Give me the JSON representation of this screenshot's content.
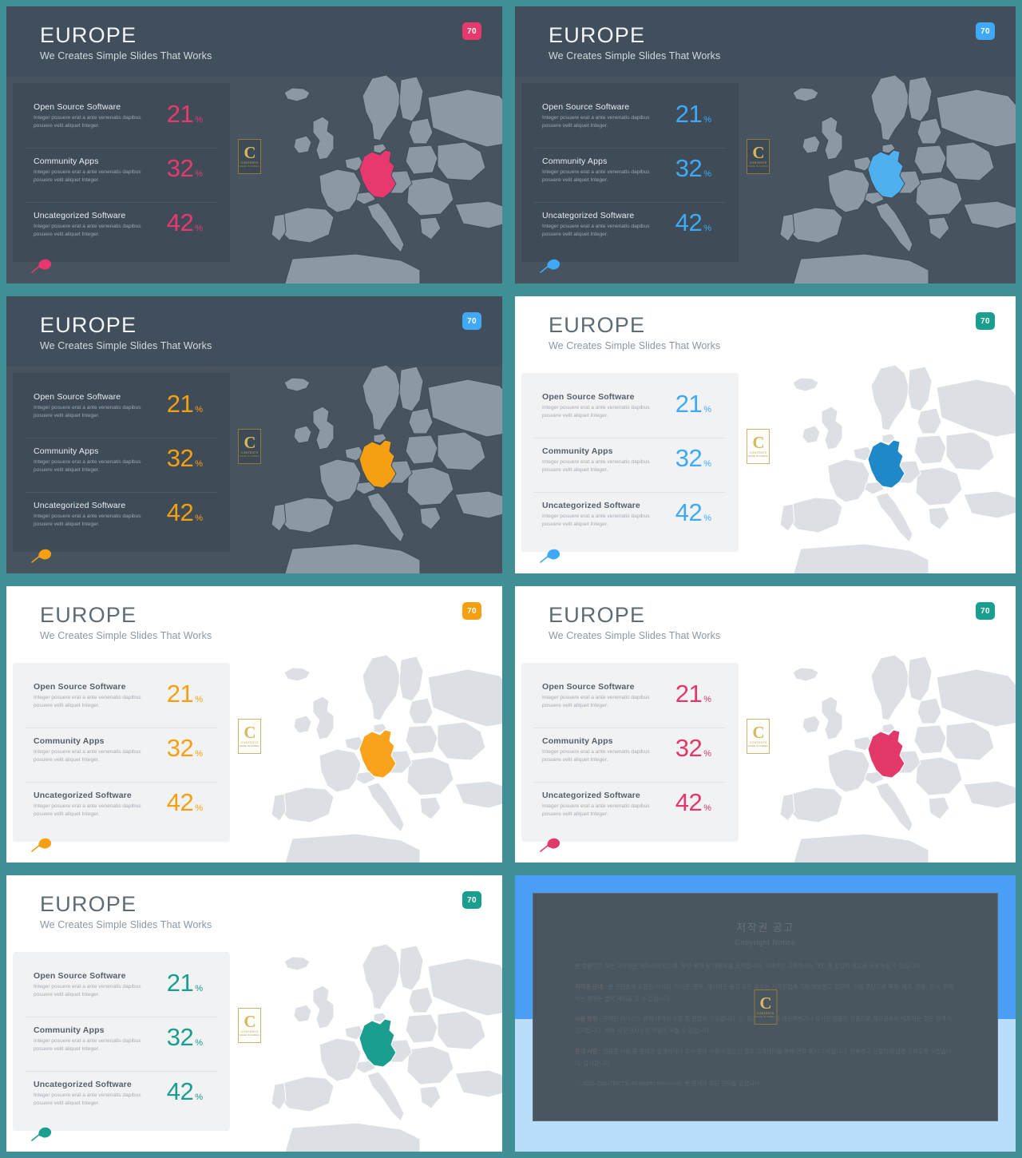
{
  "theme": {
    "frame": "#3f8f94",
    "dark_bg": "#414f5c",
    "dark_body": "#47545f",
    "dark_card": "#3f4c58",
    "light_card": "#f1f2f4",
    "pink": "#e8396f",
    "blue": "#3fa9f5",
    "orange": "#f5a011",
    "teal": "#1b9e8f",
    "blue_dark": "#1f88c9",
    "map_land_dark": "#8c99a4",
    "map_sea_dark": "#3f4d5a",
    "map_land_light": "#dcdfe4"
  },
  "header": {
    "title": "EUROPE",
    "subtitle": "We Creates Simple Slides That Works",
    "badge": "70"
  },
  "logo": {
    "letter": "C",
    "name": "CONTENTS",
    "tagline": "MADE IN KOREA"
  },
  "stats": [
    {
      "title": "Open Source Software",
      "desc": "Integer posuere erat a ante venenatis dapibus posuere velit aliquet Integer.",
      "value": "21",
      "unit": "%"
    },
    {
      "title": "Community Apps",
      "desc": "Integer posuere erat a ante venenatis dapibus posuere velit aliquet Integer.",
      "value": "32",
      "unit": "%"
    },
    {
      "title": "Uncategorized Software",
      "desc": "Integer posuere erat a ante venenatis dapibus posuere velit aliquet Integer.",
      "value": "42",
      "unit": "%"
    }
  ],
  "slides": [
    {
      "id": "slide-1",
      "mode": "dark",
      "accent": "#e8396f",
      "badge_color": "#e8396f",
      "highlight": "#e8396f",
      "pin": "#e8396f"
    },
    {
      "id": "slide-2",
      "mode": "dark",
      "accent": "#3fa9f5",
      "badge_color": "#3fa9f5",
      "highlight": "#4fb0f0",
      "pin": "#3fa9f5"
    },
    {
      "id": "slide-3",
      "mode": "dark",
      "accent": "#f5a011",
      "badge_color": "#3fa9f5",
      "highlight": "#f5a011",
      "pin": "#f5a011"
    },
    {
      "id": "slide-4",
      "mode": "light",
      "accent": "#3fa9f5",
      "badge_color": "#1b9e8f",
      "highlight": "#1f88c9",
      "pin": "#3fa9f5"
    },
    {
      "id": "slide-5",
      "mode": "light",
      "accent": "#f5a011",
      "badge_color": "#f5a011",
      "highlight": "#f9a21b",
      "pin": "#f5a011"
    },
    {
      "id": "slide-6",
      "mode": "light",
      "accent": "#e2386a",
      "badge_color": "#1b9e8f",
      "highlight": "#e2386a",
      "pin": "#e2386a"
    },
    {
      "id": "slide-7",
      "mode": "light",
      "accent": "#1b9e8f",
      "badge_color": "#1b9e8f",
      "highlight": "#1b9e8f",
      "pin": "#1b9e8f"
    }
  ],
  "copyright": {
    "title": "저작권 공고",
    "subtitle": "Copyright Notice",
    "paragraphs": [
      "본 템플릿의 모든 저작권은 제작사에 있으며, 무단 복제 및 재배포를 금지합니다. 구매하신 고객께서는 개인 및 상업적 용도로 사용하실 수 있습니다.",
      "저작권 안내 : 본 콘텐츠에 포함된 이미지, 아이콘, 폰트, 레이아웃 등의 모든 요소는 저작권법에 의해 보호받고 있으며, 이를 무단으로 복제, 배포, 전송, 전시, 판매하는 행위는 법적 책임을 질 수 있습니다.",
      "사용 범위 : 구매한 라이선스 범위 내에서 수정 및 편집이 가능합니다. 단, 템플릿 자체를 재판매하거나 유사한 템플릿 상품으로 재가공하여 배포하는 것은 엄격히 금지됩니다. 위반 시 민형사상의 책임이 따를 수 있습니다.",
      "문의 사항 : 템플릿 사용 중 문제가 발생하거나 추가 문의 사항이 있으신 경우 고객센터를 통해 연락 주시기 바랍니다. 신속하고 친절하게 답변 드리도록 하겠습니다. 감사합니다.",
      "ⓒ 2016 CONTENTS. All Rights Reserved. 본 문서의 무단 전재를 금합니다."
    ]
  }
}
